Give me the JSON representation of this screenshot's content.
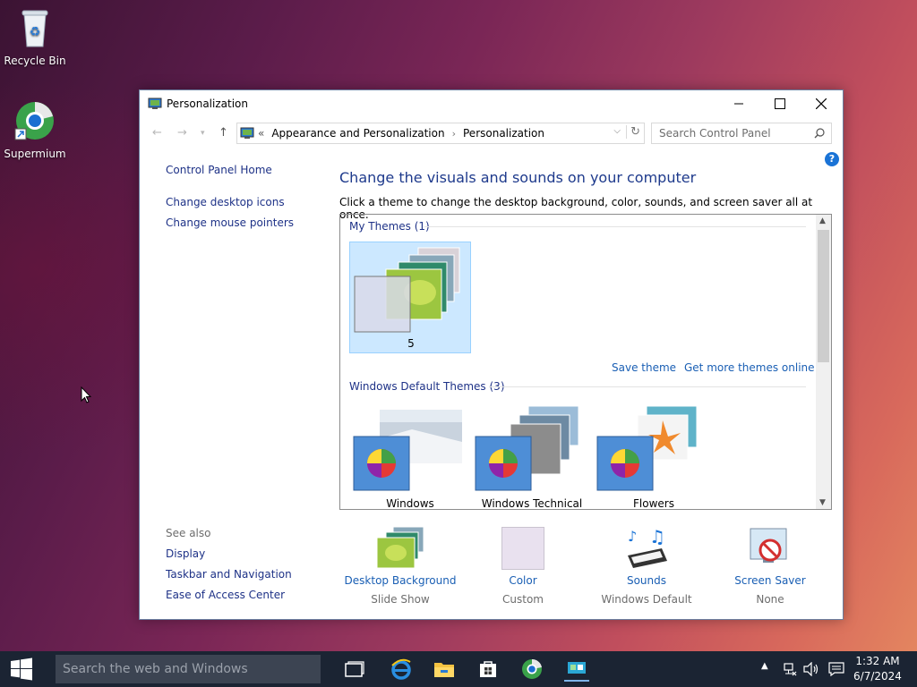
{
  "desktop": {
    "icons": [
      {
        "label": "Recycle Bin",
        "icon": "recycle-bin-icon"
      },
      {
        "label": "Supermium",
        "icon": "supermium-icon"
      }
    ]
  },
  "window": {
    "title": "Personalization",
    "address": {
      "prefix": "«",
      "crumbs": [
        "Appearance and Personalization",
        "Personalization"
      ]
    },
    "search_placeholder": "Search Control Panel",
    "left_pane": {
      "home": "Control Panel Home",
      "links": [
        "Change desktop icons",
        "Change mouse pointers"
      ],
      "see_also_title": "See also",
      "see_also": [
        "Display",
        "Taskbar and Navigation",
        "Ease of Access Center"
      ]
    },
    "main": {
      "heading": "Change the visuals and sounds on your computer",
      "description": "Click a theme to change the desktop background, color, sounds, and screen saver all at once.",
      "my_themes_title": "My Themes (1)",
      "my_themes": [
        {
          "name": "5",
          "selected": true
        }
      ],
      "save_theme": "Save theme",
      "get_more": "Get more themes online",
      "default_themes_title": "Windows Default Themes (3)",
      "default_themes": [
        {
          "name": "Windows"
        },
        {
          "name": "Windows Technical"
        },
        {
          "name": "Flowers"
        }
      ]
    },
    "bottom": [
      {
        "label": "Desktop Background",
        "value": "Slide Show",
        "icon": "desktop-background-icon"
      },
      {
        "label": "Color",
        "value": "Custom",
        "icon": "color-icon"
      },
      {
        "label": "Sounds",
        "value": "Windows Default",
        "icon": "sounds-icon"
      },
      {
        "label": "Screen Saver",
        "value": "None",
        "icon": "screen-saver-icon"
      }
    ]
  },
  "taskbar": {
    "search_placeholder": "Search the web and Windows",
    "time": "1:32 AM",
    "date": "6/7/2024"
  },
  "colors": {
    "link": "#1e3287",
    "heading": "#1e3a8c",
    "selection": "#cce8ff",
    "taskbar": "#1b2433"
  }
}
